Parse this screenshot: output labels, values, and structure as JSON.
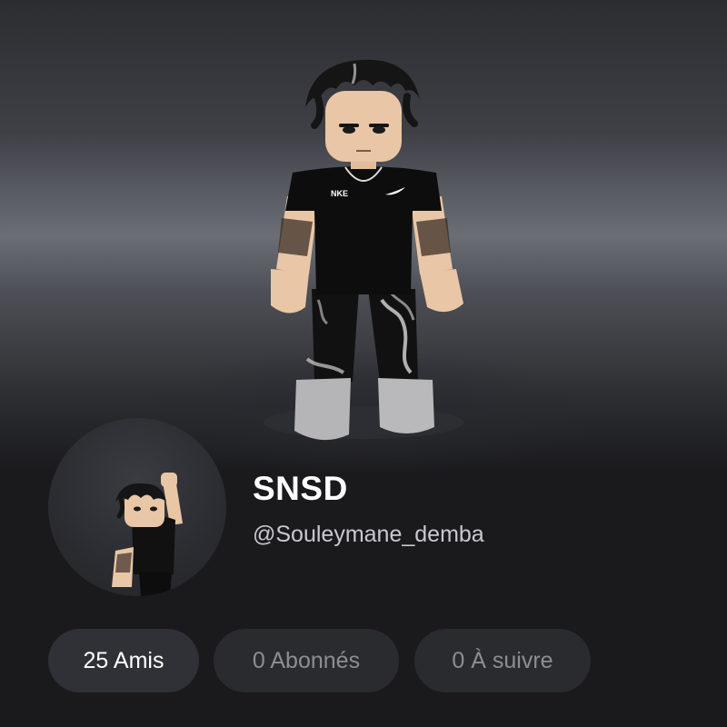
{
  "profile": {
    "display_name": "SNSD",
    "username": "@Souleymane_demba"
  },
  "stats": [
    {
      "label": "25 Amis",
      "active": true
    },
    {
      "label": "0 Abonnés",
      "active": false
    },
    {
      "label": "0 À suivre",
      "active": false
    }
  ],
  "avatar": {
    "shirt_logo_text": "NKE",
    "shirt_logo_icon": "swoosh-icon"
  },
  "colors": {
    "background": "#1a1a1d",
    "pill_active": "#303136",
    "pill_inactive": "#2a2b2f",
    "text_primary": "#ffffff",
    "text_secondary": "#c9cacd",
    "text_muted": "#8d8e93"
  }
}
